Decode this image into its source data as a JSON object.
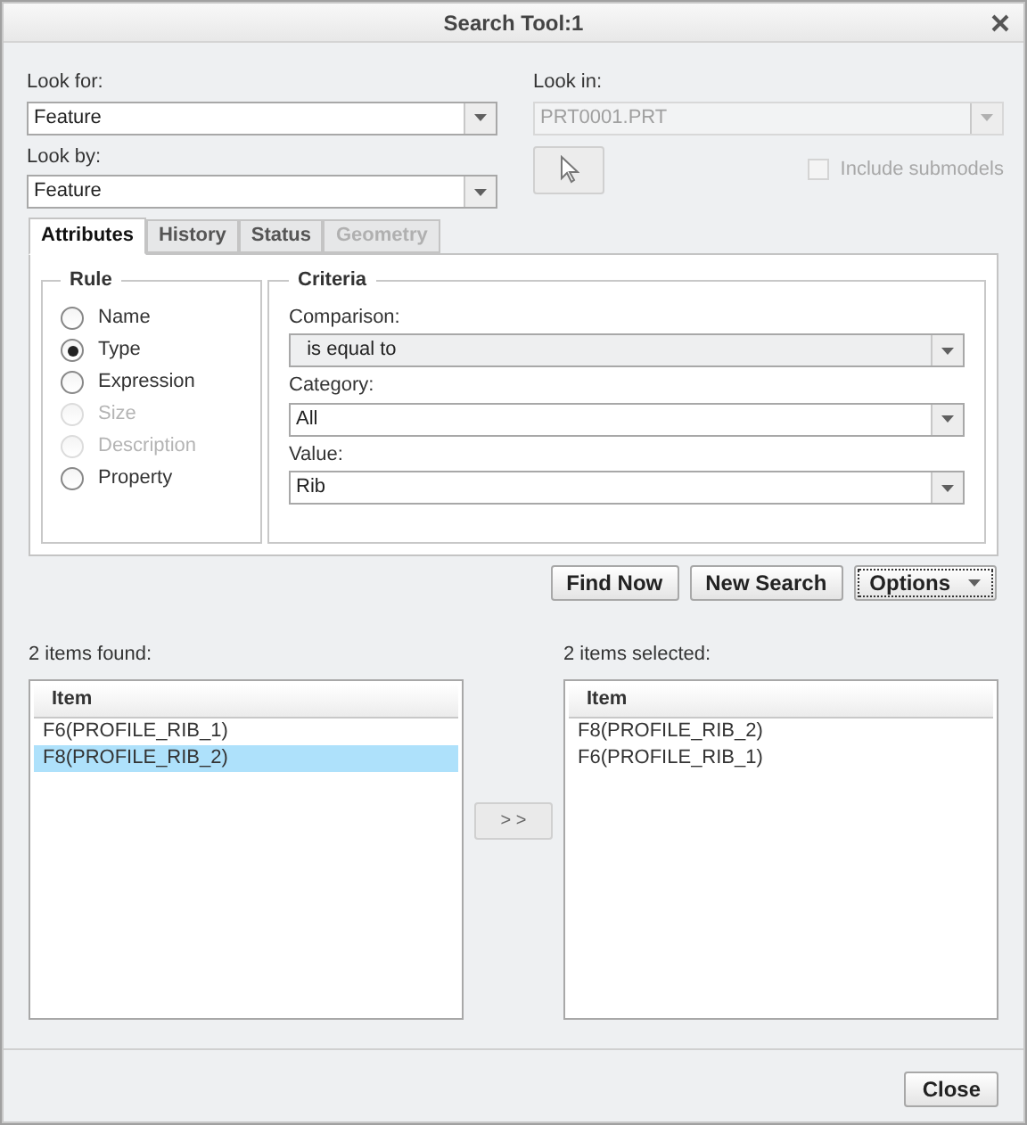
{
  "window": {
    "title": "Search Tool:1"
  },
  "look_for": {
    "label": "Look for:",
    "value": "Feature"
  },
  "look_by": {
    "label": "Look by:",
    "value": "Feature"
  },
  "look_in": {
    "label": "Look in:",
    "value": "PRT0001.PRT",
    "disabled": true
  },
  "include_submodels": {
    "label": "Include submodels",
    "checked": false,
    "disabled": true
  },
  "tabs": [
    {
      "label": "Attributes",
      "selected": true,
      "disabled": false
    },
    {
      "label": "History",
      "selected": false,
      "disabled": false
    },
    {
      "label": "Status",
      "selected": false,
      "disabled": false
    },
    {
      "label": "Geometry",
      "selected": false,
      "disabled": true
    }
  ],
  "rule": {
    "title": "Rule",
    "options": [
      {
        "label": "Name",
        "selected": false,
        "disabled": false
      },
      {
        "label": "Type",
        "selected": true,
        "disabled": false
      },
      {
        "label": "Expression",
        "selected": false,
        "disabled": false
      },
      {
        "label": "Size",
        "selected": false,
        "disabled": true
      },
      {
        "label": "Description",
        "selected": false,
        "disabled": true
      },
      {
        "label": "Property",
        "selected": false,
        "disabled": false
      }
    ]
  },
  "criteria": {
    "title": "Criteria",
    "fields": [
      {
        "label": "Comparison:",
        "value": "is equal to",
        "kind": "readonly"
      },
      {
        "label": "Category:",
        "value": "All",
        "kind": "editable"
      },
      {
        "label": "Value:",
        "value": "Rib",
        "kind": "editable"
      }
    ]
  },
  "actions": [
    "Find Now",
    "New Search",
    "Options"
  ],
  "found": {
    "label": "2 items found:",
    "column": "Item",
    "rows": [
      {
        "text": "F6(PROFILE_RIB_1)",
        "selected": false
      },
      {
        "text": "F8(PROFILE_RIB_2)",
        "selected": true
      }
    ]
  },
  "move_button": "> >",
  "chosen": {
    "label": "2 items selected:",
    "column": "Item",
    "rows": [
      {
        "text": "F8(PROFILE_RIB_2)",
        "selected": false
      },
      {
        "text": "F6(PROFILE_RIB_1)",
        "selected": false
      }
    ]
  },
  "close_button": "Close"
}
